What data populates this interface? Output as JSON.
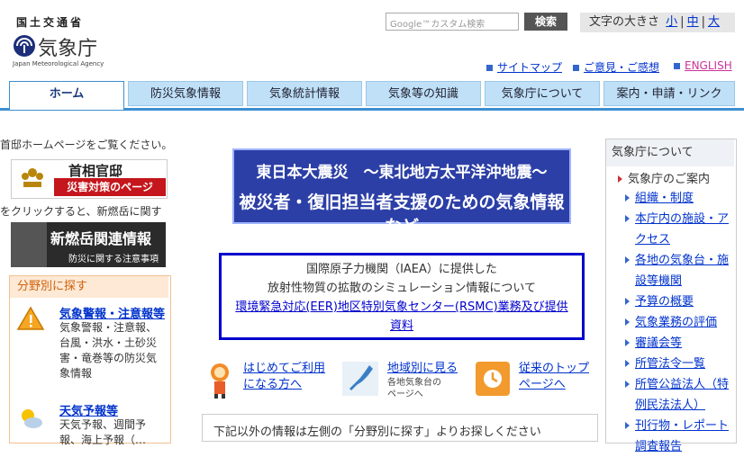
{
  "header": {
    "ministry": "国土交通省",
    "agency_name": "気象庁",
    "agency_en": "Japan Meteorological Agency",
    "search_placeholder": "Google™カスタム検索",
    "search_button": "検索",
    "font_size_label": "文字の大きさ",
    "font_small": "小",
    "font_medium": "中",
    "font_large": "大",
    "links": {
      "sitemap": "サイトマップ",
      "feedback": "ご意見・ご感想",
      "english": "ENGLISH"
    }
  },
  "nav": {
    "tabs": [
      "ホーム",
      "防災気象情報",
      "気象統計情報",
      "気象等の知識",
      "気象庁について",
      "案内・申請・リンク"
    ]
  },
  "left": {
    "intro_text": "首邸ホームページをご覧ください。",
    "kantei_title": "首相官邸",
    "kantei_sub": "災害対策のページ",
    "shinmoe_intro": "をクリックすると、新燃岳に関す",
    "shinmoe_title": "新燃岳関連情報",
    "shinmoe_sub": "防災に関する注意事項",
    "bunya_heading": "分野別に探す",
    "items": [
      {
        "title": "気象警報・注意報等",
        "desc": [
          "気象警報・注意報、",
          "台風・洪水・土砂災",
          "害・竜巻等の防災気",
          "象情報"
        ]
      },
      {
        "title": "天気予報等",
        "desc": [
          "天気予報、週間予",
          "報、海上予報（…"
        ]
      }
    ]
  },
  "center": {
    "banner_line1": "東日本大震災　～東北地方太平洋沖地震～",
    "banner_line2": "被災者・復旧担当者支援のための気象情報など",
    "iaea_line1": "国際原子力機関（IAEA）に提供した",
    "iaea_line2": "放射性物質の拡散のシミュレーション情報について",
    "iaea_link1": "環境緊急対応(EER)地区特別気象センター(RSMC)業務及び提供",
    "iaea_link2": "資料",
    "quick": [
      {
        "line1": "はじめてご利用",
        "line2": "になる方へ",
        "sub1": "",
        "sub2": ""
      },
      {
        "line1": "地域別に見る",
        "line2": "",
        "sub1": "各地気象台の",
        "sub2": "ページへ"
      },
      {
        "line1": "従来のトップ",
        "line2": "ページへ",
        "sub1": "",
        "sub2": ""
      }
    ],
    "notice": "下記以外の情報は左側の「分野別に探す」よりお探しください"
  },
  "right": {
    "heading": "気象庁について",
    "section": "気象庁のご案内",
    "items": [
      "組織・制度",
      "本庁内の施設・ア",
      "クセス",
      "各地の気象台・施",
      "設等機関",
      "予算の概要",
      "気象業務の評価",
      "審議会等",
      "所管法令一覧",
      "所管公益法人（特",
      "例民法法人）",
      "刊行物・レポート",
      "調査報告"
    ]
  },
  "colors": {
    "nav_active_border": "#3d8fd0",
    "nav_tab_bg": "#bfe0f7",
    "link": "#0033cc",
    "banner_bg": "#2c3fa6",
    "iaea_border": "#0000cc"
  }
}
